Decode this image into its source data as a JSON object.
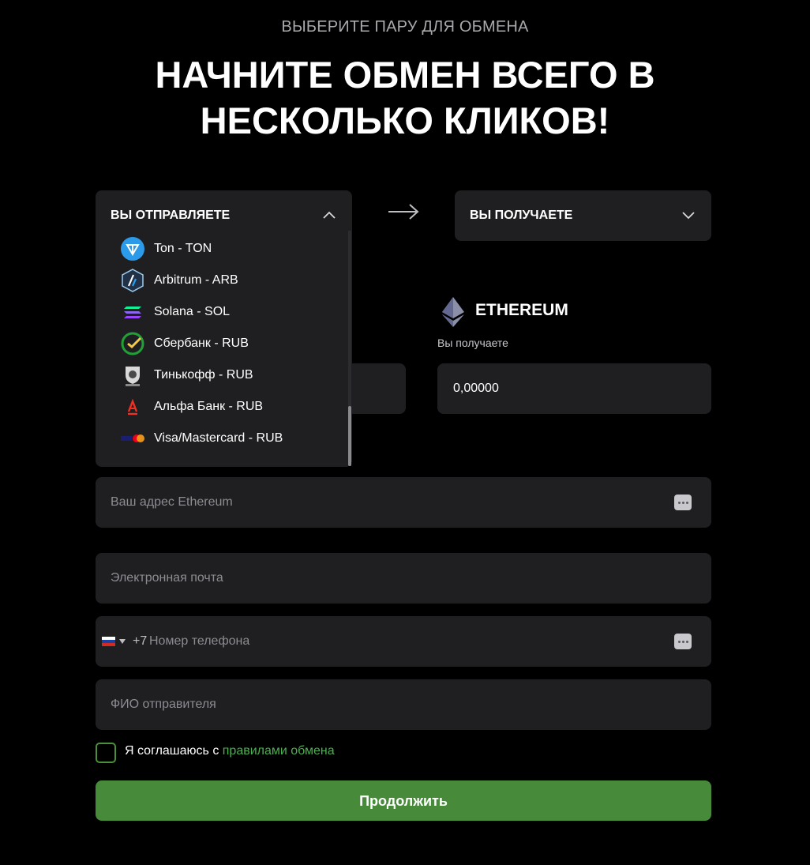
{
  "header": {
    "subtitle": "ВЫБЕРИТЕ ПАРУ ДЛЯ ОБМЕНА",
    "title_line1": "НАЧНИТЕ ОБМЕН ВСЕГО В",
    "title_line2": "НЕСКОЛЬКО КЛИКОВ!"
  },
  "send_select": {
    "label": "ВЫ ОТПРАВЛЯЕТЕ",
    "expanded": true,
    "options": [
      {
        "label": "Ton - TON",
        "icon": "ton-icon"
      },
      {
        "label": "Arbitrum - ARB",
        "icon": "arbitrum-icon"
      },
      {
        "label": "Solana - SOL",
        "icon": "solana-icon"
      },
      {
        "label": "Сбербанк - RUB",
        "icon": "sberbank-icon"
      },
      {
        "label": "Тинькофф - RUB",
        "icon": "tinkoff-icon"
      },
      {
        "label": "Альфа Банк - RUB",
        "icon": "alfabank-icon"
      },
      {
        "label": "Visa/Mastercard - RUB",
        "icon": "visa-mastercard-icon"
      }
    ]
  },
  "receive_select": {
    "label": "ВЫ ПОЛУЧАЕТЕ"
  },
  "receive": {
    "currency_name": "ETHEREUM",
    "amount_label": "Вы получаете",
    "amount_value": "0,00000"
  },
  "form": {
    "address_placeholder": "Ваш адрес Ethereum",
    "email_placeholder": "Электронная почта",
    "phone_prefix": "+7",
    "phone_placeholder": "Номер телефона",
    "name_placeholder": "ФИО отправителя",
    "agree_text": "Я соглашаюсь с",
    "agree_link": "правилами обмена",
    "agreed": false,
    "continue_label": "Продолжить"
  },
  "colors": {
    "background": "#000000",
    "panel": "#1f1f22",
    "accent_green": "#468a3a",
    "link_green": "#4caf50"
  }
}
